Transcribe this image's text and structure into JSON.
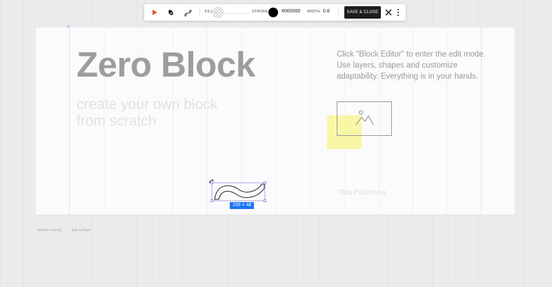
{
  "toolbar": {
    "fill_label": "FILL",
    "stroke_label": "STROKE",
    "stroke_value": "#000000",
    "width_label": "WIDTH",
    "width_value": "0.8",
    "save_label": "SAVE & CLOSE",
    "icons": [
      "play-icon",
      "pen-nib-icon",
      "bezier-path-icon",
      "close-icon",
      "more-vertical-icon"
    ],
    "accent_color": "#e4572e"
  },
  "artboard": {
    "heading": "Zero Block",
    "subheading": "create your own block from scratch",
    "description": "Click \"Block Editor\" to enter the edit mode. Use layers, shapes and customize adaptability. Everything is in your hands.",
    "footer_brand": "Tilda Publishing",
    "shape_size": "155 × 48",
    "highlight_color": "#f7f7a0",
    "selection_color": "#1974f6"
  },
  "bottom_links": [
    "window resizing",
    "grid settings"
  ]
}
